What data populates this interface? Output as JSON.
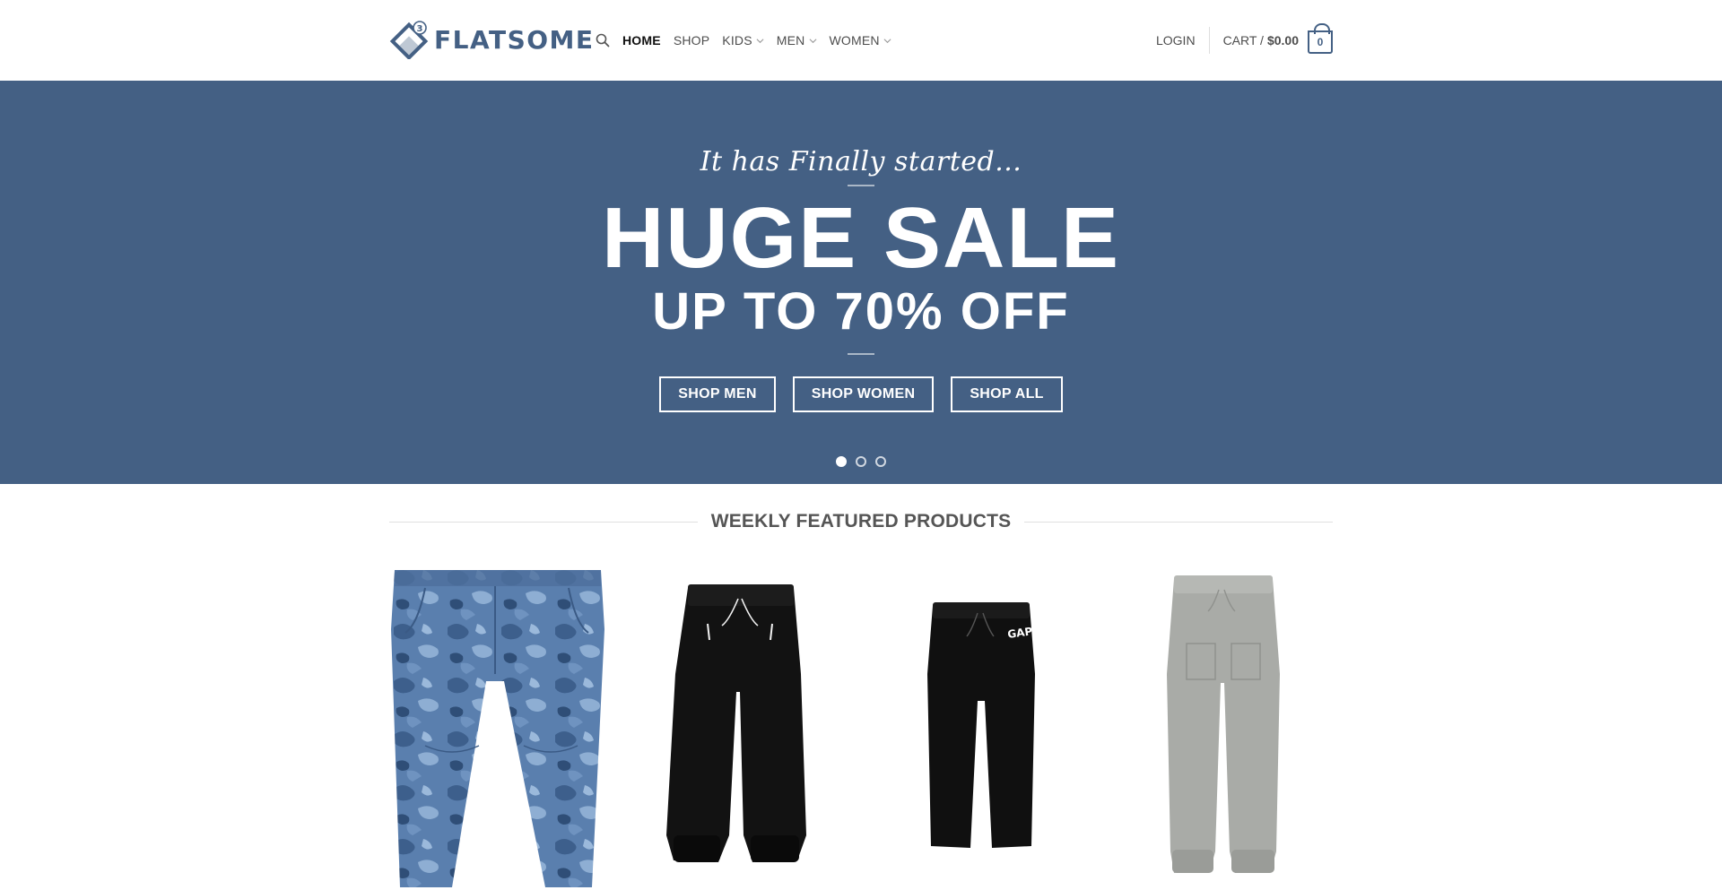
{
  "header": {
    "logo_text": "FLATSOME",
    "logo_badge": "3",
    "nav": [
      {
        "label": "HOME",
        "active": true,
        "dropdown": false
      },
      {
        "label": "SHOP",
        "active": false,
        "dropdown": false
      },
      {
        "label": "KIDS",
        "active": false,
        "dropdown": true
      },
      {
        "label": "MEN",
        "active": false,
        "dropdown": true
      },
      {
        "label": "WOMEN",
        "active": false,
        "dropdown": true
      }
    ],
    "login_label": "LOGIN",
    "cart_label": "CART /",
    "cart_amount": "$0.00",
    "cart_count": "0"
  },
  "hero": {
    "script_text": "It has Finally started...",
    "title": "HUGE SALE",
    "subtitle": "UP TO 70% OFF",
    "buttons": [
      "SHOP MEN",
      "SHOP WOMEN",
      "SHOP ALL"
    ],
    "slides": 3,
    "active_slide": 1,
    "background_color": "#446084"
  },
  "featured": {
    "title": "WEEKLY FEATURED PRODUCTS",
    "products": [
      {
        "image": "blue-camo-jogger-pants"
      },
      {
        "image": "black-fleece-jogger-pants"
      },
      {
        "image": "black-gap-logo-sweatpants"
      },
      {
        "image": "gray-pull-on-jogger-pants"
      }
    ]
  },
  "colors": {
    "primary": "#446084",
    "text": "#4d4d4d"
  }
}
